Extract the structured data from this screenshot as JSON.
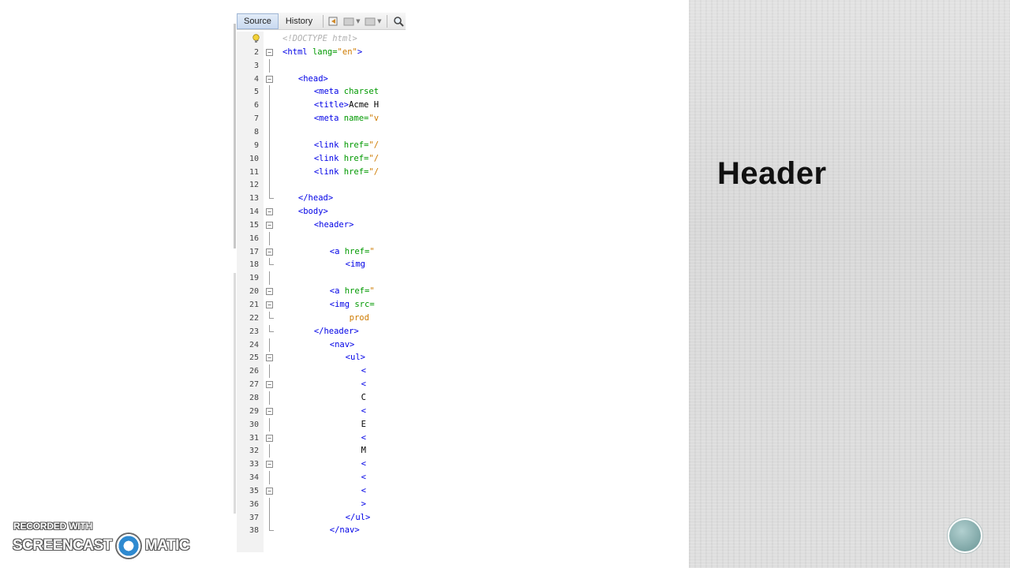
{
  "editor": {
    "tabs": [
      {
        "label": "Source",
        "active": true
      },
      {
        "label": "History",
        "active": false
      }
    ],
    "toolbar_icons": [
      "back-history-icon",
      "prev-bookmark-icon",
      "next-bookmark-icon",
      "find-icon"
    ],
    "lines": [
      {
        "n": "1",
        "code": [
          [
            "t-doc",
            "<!DOCTYPE html>"
          ]
        ],
        "indent": 0
      },
      {
        "n": "2",
        "code": [
          [
            "t-tag",
            "<html "
          ],
          [
            "t-attr",
            "lang="
          ],
          [
            "t-val",
            "\"en\""
          ],
          [
            "t-tag",
            ">"
          ]
        ],
        "indent": 0,
        "fold": "open"
      },
      {
        "n": "3",
        "code": [],
        "indent": 0
      },
      {
        "n": "4",
        "code": [
          [
            "t-tag",
            "<head>"
          ]
        ],
        "indent": 4,
        "fold": "open"
      },
      {
        "n": "5",
        "code": [
          [
            "t-tag",
            "<meta "
          ],
          [
            "t-attr",
            "charset"
          ]
        ],
        "indent": 8
      },
      {
        "n": "6",
        "code": [
          [
            "t-tag",
            "<title>"
          ],
          [
            "t-text",
            "Acme H"
          ]
        ],
        "indent": 8
      },
      {
        "n": "7",
        "code": [
          [
            "t-tag",
            "<meta "
          ],
          [
            "t-attr",
            "name="
          ],
          [
            "t-val",
            "\"v"
          ]
        ],
        "indent": 8
      },
      {
        "n": "8",
        "code": [],
        "indent": 0
      },
      {
        "n": "9",
        "code": [
          [
            "t-tag",
            "<link "
          ],
          [
            "t-attr",
            "href="
          ],
          [
            "t-val",
            "\"/"
          ]
        ],
        "indent": 8
      },
      {
        "n": "10",
        "code": [
          [
            "t-tag",
            "<link "
          ],
          [
            "t-attr",
            "href="
          ],
          [
            "t-val",
            "\"/"
          ]
        ],
        "indent": 8
      },
      {
        "n": "11",
        "code": [
          [
            "t-tag",
            "<link "
          ],
          [
            "t-attr",
            "href="
          ],
          [
            "t-val",
            "\"/"
          ]
        ],
        "indent": 8
      },
      {
        "n": "12",
        "code": [],
        "indent": 0
      },
      {
        "n": "13",
        "code": [
          [
            "t-tag",
            "</head>"
          ]
        ],
        "indent": 4,
        "fold": "end"
      },
      {
        "n": "14",
        "code": [
          [
            "t-tag",
            "<body>"
          ]
        ],
        "indent": 4,
        "fold": "open"
      },
      {
        "n": "15",
        "code": [
          [
            "t-tag",
            "<header>"
          ]
        ],
        "indent": 8,
        "fold": "open"
      },
      {
        "n": "16",
        "code": [],
        "indent": 0
      },
      {
        "n": "17",
        "code": [
          [
            "t-tag",
            "<a "
          ],
          [
            "t-attr",
            "href="
          ],
          [
            "t-val",
            "\""
          ]
        ],
        "indent": 12,
        "fold": "open"
      },
      {
        "n": "18",
        "code": [
          [
            "t-tag",
            "<img"
          ]
        ],
        "indent": 16,
        "fold": "end"
      },
      {
        "n": "19",
        "code": [],
        "indent": 0
      },
      {
        "n": "20",
        "code": [
          [
            "t-tag",
            "<a "
          ],
          [
            "t-attr",
            "href="
          ],
          [
            "t-val",
            "\""
          ]
        ],
        "indent": 12,
        "fold": "open"
      },
      {
        "n": "21",
        "code": [
          [
            "t-tag",
            "<img "
          ],
          [
            "t-attr",
            "src="
          ]
        ],
        "indent": 12,
        "fold": "open"
      },
      {
        "n": "22",
        "code": [
          [
            "t-val",
            "prod"
          ]
        ],
        "indent": 17,
        "fold": "end"
      },
      {
        "n": "23",
        "code": [
          [
            "t-tag",
            "</header>"
          ]
        ],
        "indent": 8,
        "fold": "end"
      },
      {
        "n": "24",
        "code": [
          [
            "t-tag",
            "<nav>"
          ]
        ],
        "indent": 12
      },
      {
        "n": "25",
        "code": [
          [
            "t-tag",
            "<ul>"
          ]
        ],
        "indent": 16,
        "fold": "open"
      },
      {
        "n": "26",
        "code": [
          [
            "t-tag",
            "<"
          ]
        ],
        "indent": 20
      },
      {
        "n": "27",
        "code": [
          [
            "t-tag",
            "<"
          ]
        ],
        "indent": 20,
        "fold": "open"
      },
      {
        "n": "28",
        "code": [
          [
            "t-text",
            "C"
          ]
        ],
        "indent": 20
      },
      {
        "n": "29",
        "code": [
          [
            "t-tag",
            "<"
          ]
        ],
        "indent": 20,
        "fold": "open"
      },
      {
        "n": "30",
        "code": [
          [
            "t-text",
            "E"
          ]
        ],
        "indent": 20
      },
      {
        "n": "31",
        "code": [
          [
            "t-tag",
            "<"
          ]
        ],
        "indent": 20,
        "fold": "open"
      },
      {
        "n": "32",
        "code": [
          [
            "t-text",
            "M"
          ]
        ],
        "indent": 20
      },
      {
        "n": "33",
        "code": [
          [
            "t-tag",
            "<"
          ]
        ],
        "indent": 20,
        "fold": "open"
      },
      {
        "n": "34",
        "code": [
          [
            "t-tag",
            "<"
          ]
        ],
        "indent": 20
      },
      {
        "n": "35",
        "code": [
          [
            "t-tag",
            "<"
          ]
        ],
        "indent": 20,
        "fold": "open"
      },
      {
        "n": "36",
        "code": [
          [
            "t-tag",
            ">"
          ]
        ],
        "indent": 20
      },
      {
        "n": "37",
        "code": [
          [
            "t-tag",
            "</ul>"
          ]
        ],
        "indent": 16
      },
      {
        "n": "38",
        "code": [
          [
            "t-tag",
            "</nav>"
          ]
        ],
        "indent": 12,
        "fold": "end"
      }
    ]
  },
  "slide": {
    "heading": "Header"
  },
  "watermark": {
    "recorded_with": "RECORDED WITH",
    "brand_left": "SCREENCAST",
    "brand_right": "MATIC"
  }
}
